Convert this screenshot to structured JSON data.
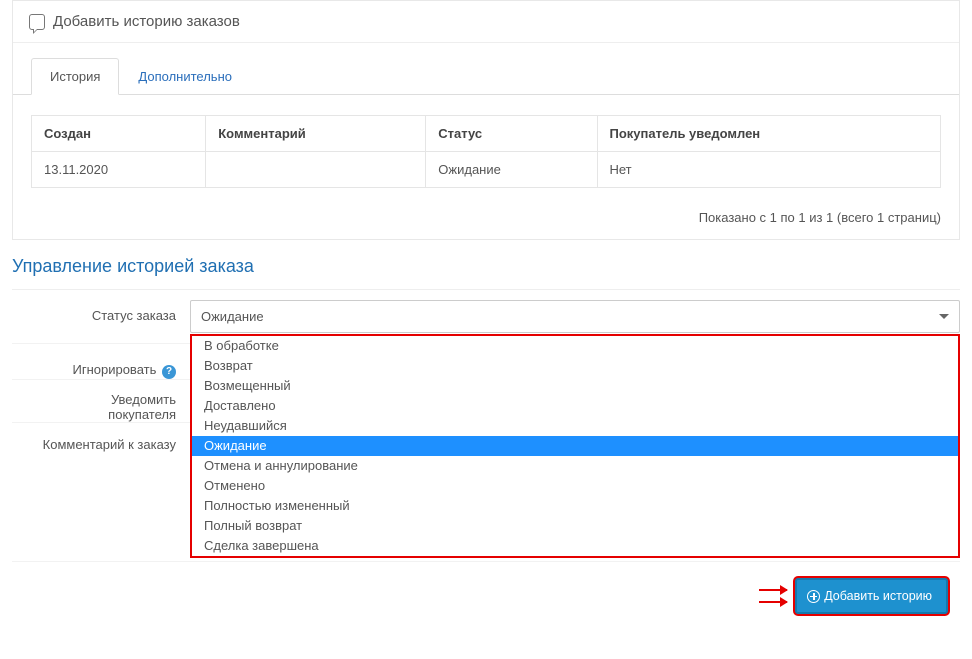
{
  "panel": {
    "title": "Добавить историю заказов"
  },
  "tabs": [
    {
      "label": "История",
      "active": true
    },
    {
      "label": "Дополнительно",
      "active": false
    }
  ],
  "history_table": {
    "headers": [
      "Создан",
      "Комментарий",
      "Статус",
      "Покупатель уведомлен"
    ],
    "rows": [
      {
        "created": "13.11.2020",
        "comment": "",
        "status": "Ожидание",
        "notified": "Нет"
      }
    ]
  },
  "pagination": {
    "text": "Показано с 1 по 1 из 1 (всего 1 страниц)"
  },
  "section": {
    "title": "Управление историей заказа"
  },
  "form": {
    "status_label": "Статус заказа",
    "status_value": "Ожидание",
    "status_options": [
      "В обработке",
      "Возврат",
      "Возмещенный",
      "Доставлено",
      "Неудавшийся",
      "Ожидание",
      "Отмена и аннулирование",
      "Отменено",
      "Полностью измененный",
      "Полный возврат",
      "Сделка завершена"
    ],
    "status_selected_index": 5,
    "ignore_label": "Игнорировать",
    "notify_label_1": "Уведомить",
    "notify_label_2": "покупателя",
    "comment_label": "Комментарий к заказу",
    "comment_value": ""
  },
  "buttons": {
    "add_history": "Добавить историю"
  },
  "icons": {
    "comment": "comment-icon",
    "help": "?",
    "plus": "plus-circle"
  },
  "colors": {
    "primary": "#1e91cf",
    "highlight_border": "#e50000",
    "link": "#2a6ebb",
    "title": "#1f6fb2",
    "dropdown_selected": "#1e90ff"
  }
}
